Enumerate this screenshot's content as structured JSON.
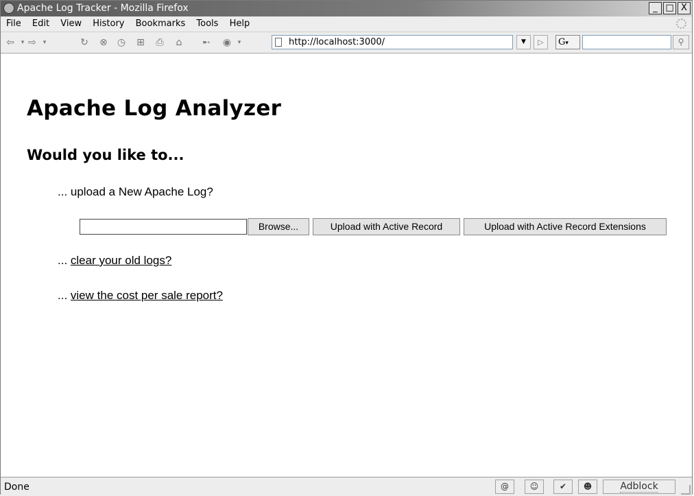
{
  "window": {
    "title": "Apache Log Tracker - Mozilla Firefox",
    "minimize": "_",
    "maximize": "□",
    "close": "X"
  },
  "menu": [
    "File",
    "Edit",
    "View",
    "History",
    "Bookmarks",
    "Tools",
    "Help"
  ],
  "nav": {
    "url": "http://localhost:3000/",
    "search_engine": "G",
    "search_value": ""
  },
  "page": {
    "heading": "Apache Log Analyzer",
    "subheading": "Would you like to...",
    "upload_prompt": "... upload a New Apache Log?",
    "browse_label": "Browse...",
    "upload_ar_label": "Upload with Active Record",
    "upload_are_label": "Upload with Active Record Extensions",
    "clear_prefix": "... ",
    "clear_link": "clear your old logs?",
    "report_prefix": "... ",
    "report_link": "view the cost per sale report?"
  },
  "status": {
    "text": "Done",
    "adblock": "Adblock"
  }
}
